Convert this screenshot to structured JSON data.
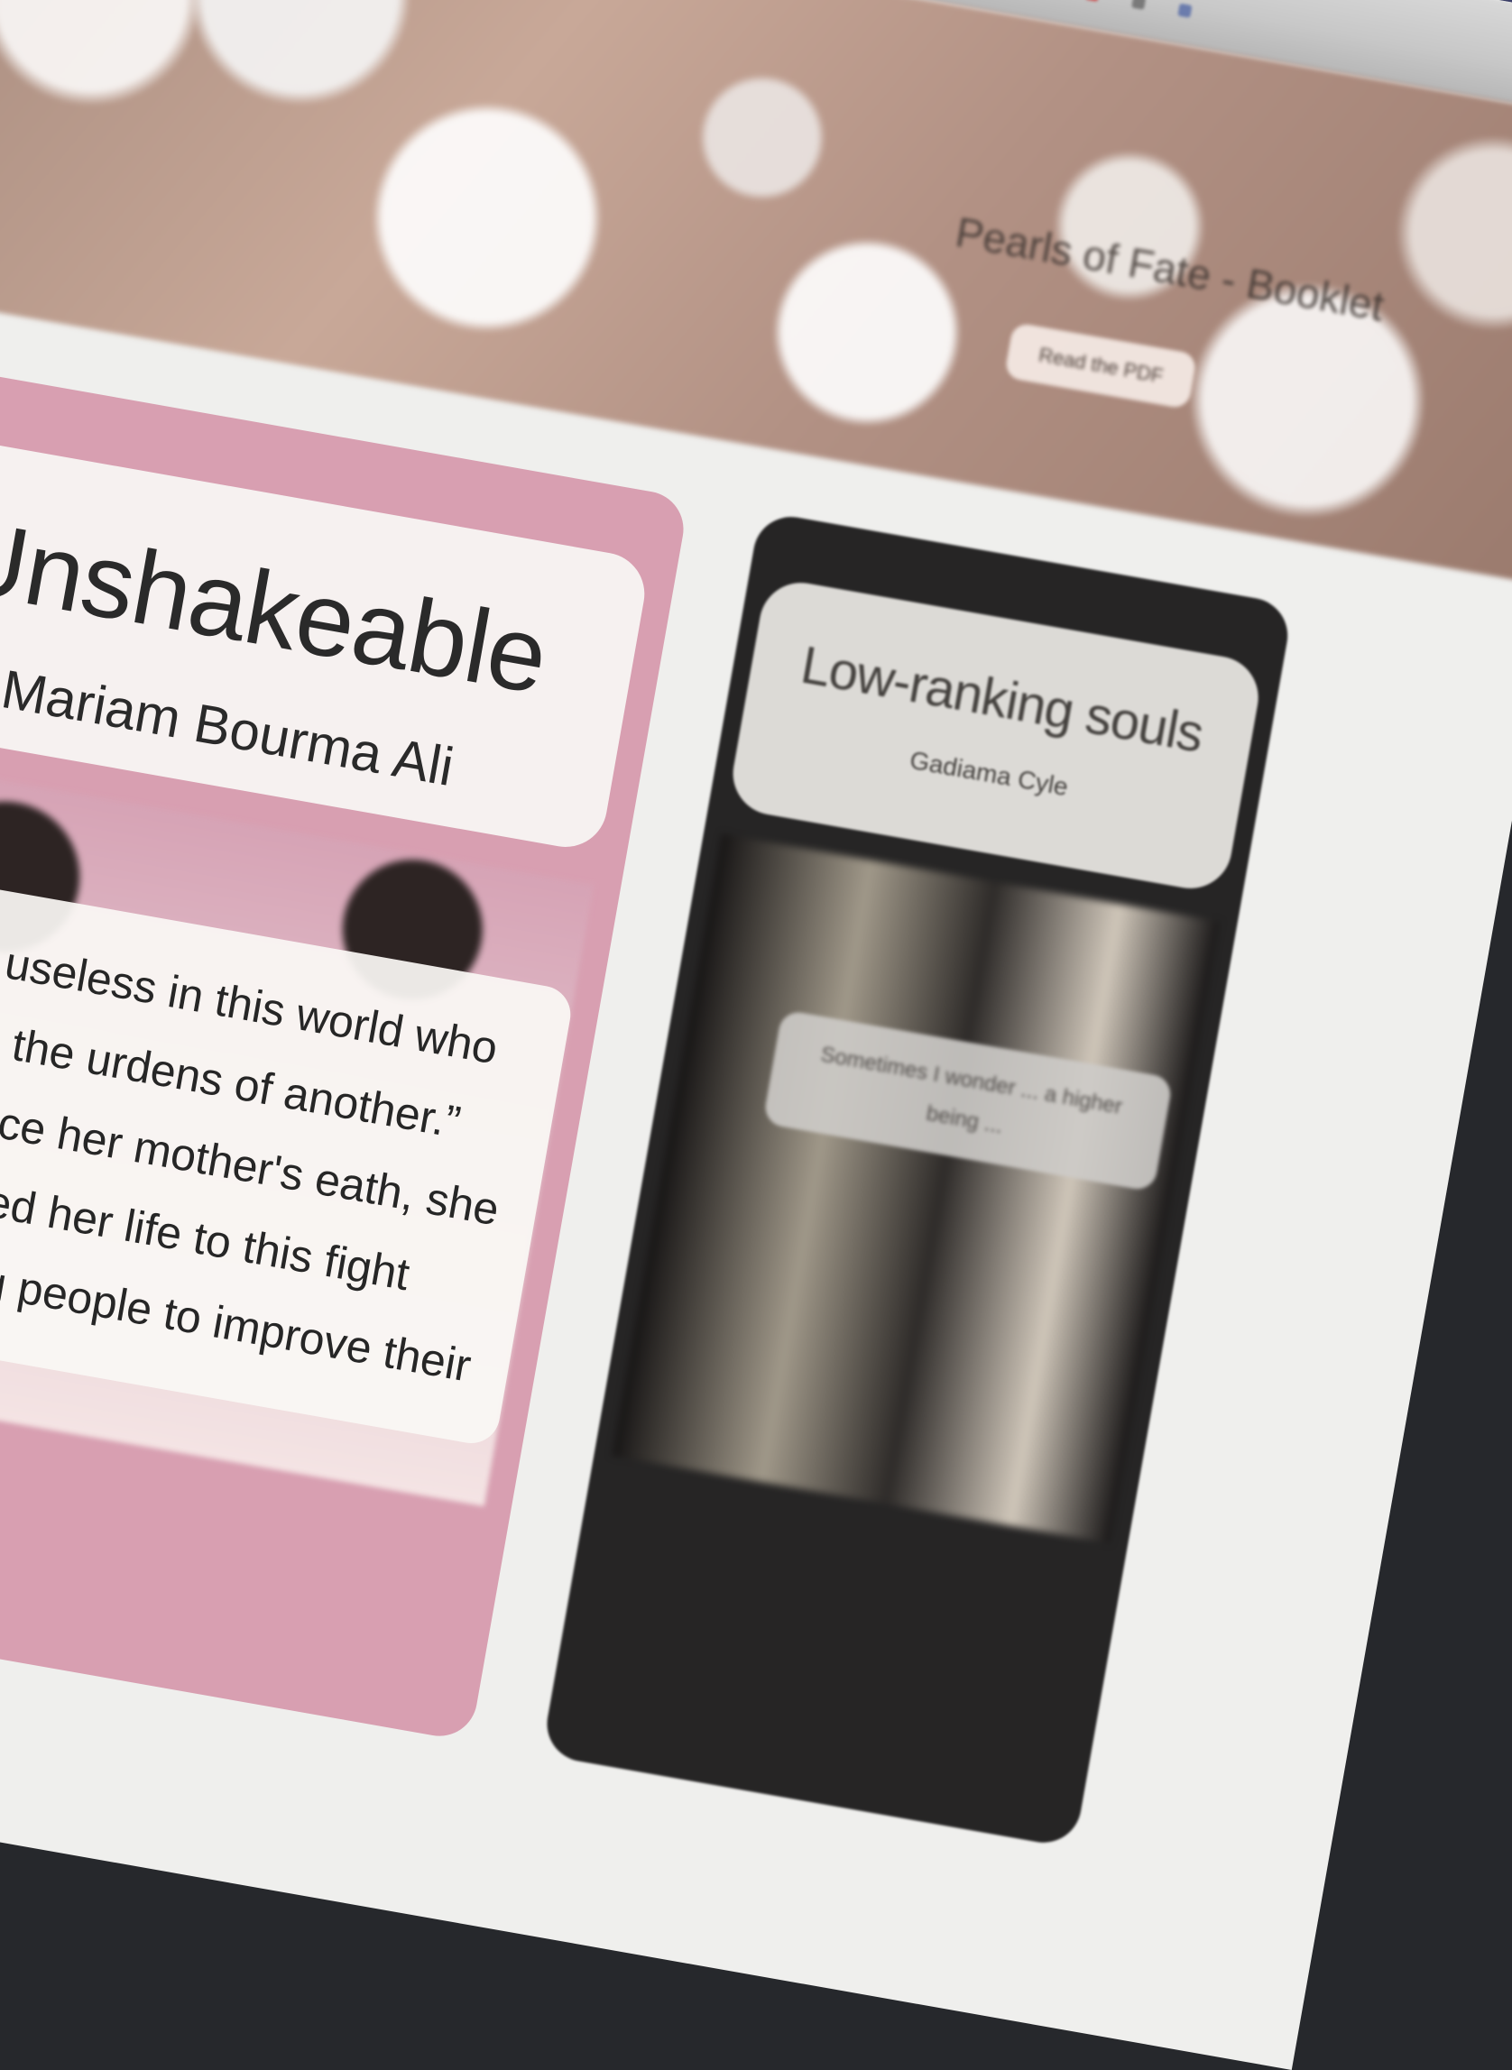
{
  "hero": {
    "title": "Pearls of Fate - Booklet",
    "button_label": "Read the PDF"
  },
  "cards": [
    {
      "title": "Unshakeable",
      "author": "Mariam Bourma Ali",
      "excerpt": "o one is useless in this world who lightens the urdens of another.” Indeed, since her mother's eath, she dedicated her life to this fight against ...ing people to improve their"
    },
    {
      "title": "Low-ranking souls",
      "author": "Gadiama Cyle",
      "excerpt": "Sometimes I wonder ... a higher being ..."
    }
  ],
  "colors": {
    "card_pink": "#d89fb1",
    "card_dark": "#262525",
    "page_bg": "#efefed"
  }
}
